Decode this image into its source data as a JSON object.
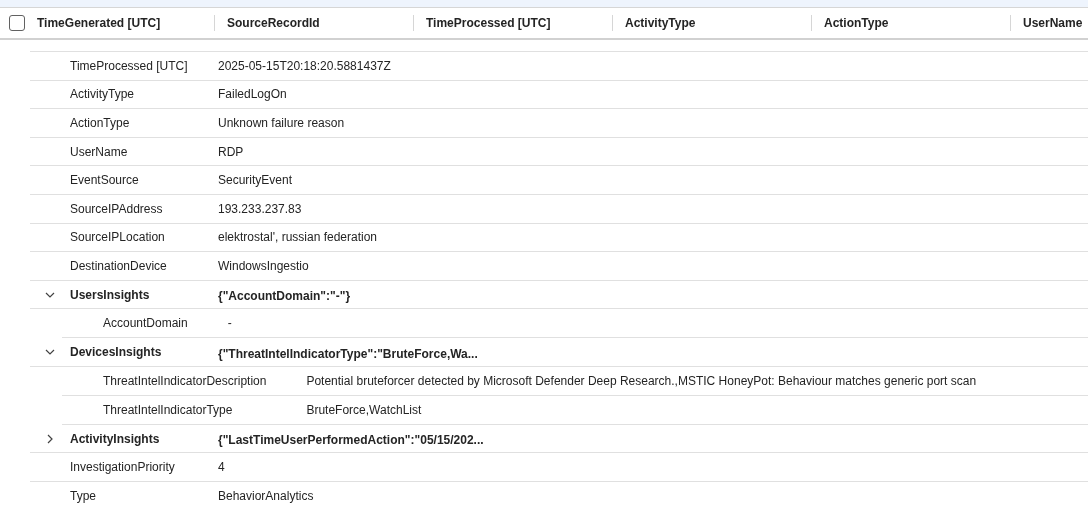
{
  "table": {
    "select_all": {
      "checked": false
    },
    "columns": [
      "TimeGenerated [UTC]",
      "SourceRecordId",
      "TimeProcessed [UTC]",
      "ActivityType",
      "ActionType",
      "UserName"
    ]
  },
  "details": [
    {
      "kind": "field",
      "label": "TimeProcessed [UTC]",
      "value": "2025-05-15T20:18:20.5881437Z"
    },
    {
      "kind": "field",
      "label": "ActivityType",
      "value": "FailedLogOn"
    },
    {
      "kind": "field",
      "label": "ActionType",
      "value": "Unknown failure reason"
    },
    {
      "kind": "field",
      "label": "UserName",
      "value": "RDP"
    },
    {
      "kind": "field",
      "label": "EventSource",
      "value": "SecurityEvent"
    },
    {
      "kind": "field",
      "label": "SourceIPAddress",
      "value": "193.233.237.83"
    },
    {
      "kind": "field",
      "label": "SourceIPLocation",
      "value": "elektrostal', russian federation"
    },
    {
      "kind": "field",
      "label": "DestinationDevice",
      "value": "WindowsIngestio"
    },
    {
      "kind": "group",
      "label": "UsersInsights",
      "value": "{\"AccountDomain\":\"-\"}",
      "expanded": true,
      "children": [
        {
          "label": "AccountDomain",
          "value": "-"
        }
      ]
    },
    {
      "kind": "group",
      "label": "DevicesInsights",
      "value": "{\"ThreatIntelIndicatorType\":\"BruteForce,Wa...",
      "expanded": true,
      "children": [
        {
          "label": "ThreatIntelIndicatorDescription",
          "value": "Potential bruteforcer detected by Microsoft Defender Deep Research.,MSTIC HoneyPot: Behaviour matches generic port scan"
        },
        {
          "label": "ThreatIntelIndicatorType",
          "value": "BruteForce,WatchList"
        }
      ]
    },
    {
      "kind": "group",
      "label": "ActivityInsights",
      "value": "{\"LastTimeUserPerformedAction\":\"05/15/202...",
      "expanded": false
    },
    {
      "kind": "field",
      "label": "InvestigationPriority",
      "value": "4"
    },
    {
      "kind": "field",
      "label": "Type",
      "value": "BehaviorAnalytics"
    }
  ]
}
